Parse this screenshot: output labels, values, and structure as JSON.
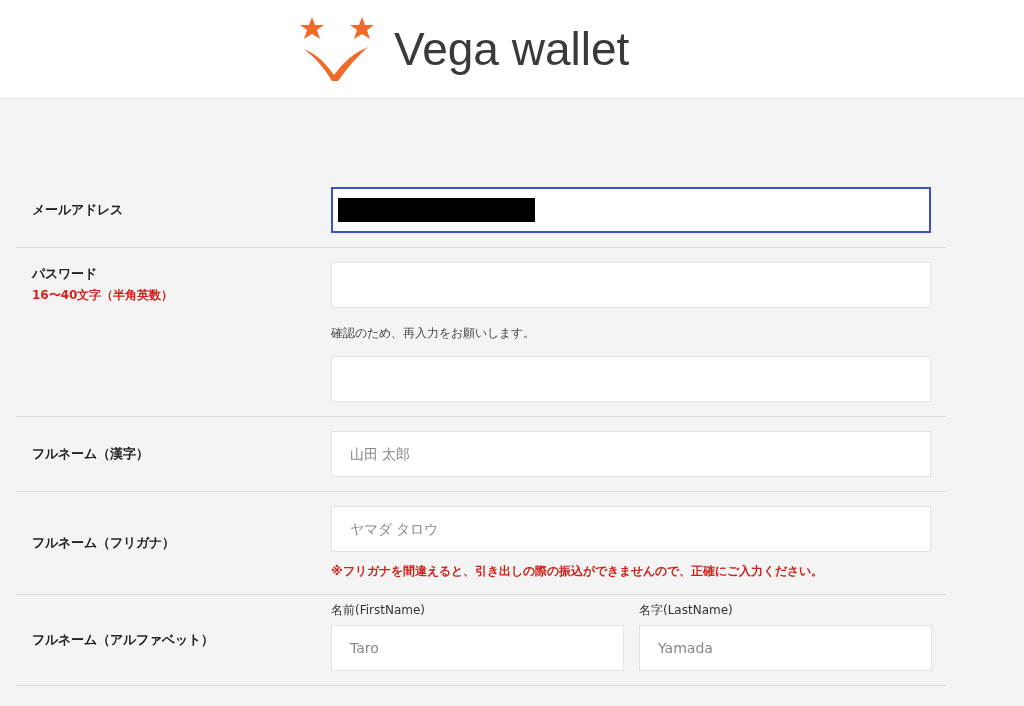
{
  "header": {
    "logo_text": "Vega wallet"
  },
  "rows": [
    {
      "label": "メールアドレス",
      "fields": [
        {
          "kind": "input",
          "focused": true,
          "redacted": true
        }
      ]
    },
    {
      "label": "パスワード",
      "note": "16〜40文字（半角英数）",
      "fields": [
        {
          "kind": "input",
          "focused": false,
          "redacted": false
        },
        {
          "kind": "hint",
          "text": "確認のため、再入力をお願いします。"
        },
        {
          "kind": "input",
          "focused": false,
          "redacted": false
        }
      ]
    },
    {
      "label": "フルネーム（漢字）",
      "fields": [
        {
          "kind": "input",
          "focused": false,
          "redacted": false,
          "placeholder": "山田 太郎"
        }
      ]
    },
    {
      "label": "フルネーム（フリガナ）",
      "fields": [
        {
          "kind": "input",
          "focused": false,
          "redacted": false,
          "placeholder": "ヤマダ タロウ"
        },
        {
          "kind": "warning",
          "text": "※フリガナを間違えると、引き出しの際の振込ができませんので、正確にご入力ください。"
        }
      ]
    },
    {
      "label": "フルネーム（アルファベット）",
      "fields": [
        {
          "kind": "pair",
          "items": [
            {
              "label": "名前(FirstName)",
              "placeholder": "Taro"
            },
            {
              "label": "名字(LastName)",
              "placeholder": "Yamada"
            }
          ]
        }
      ]
    }
  ]
}
